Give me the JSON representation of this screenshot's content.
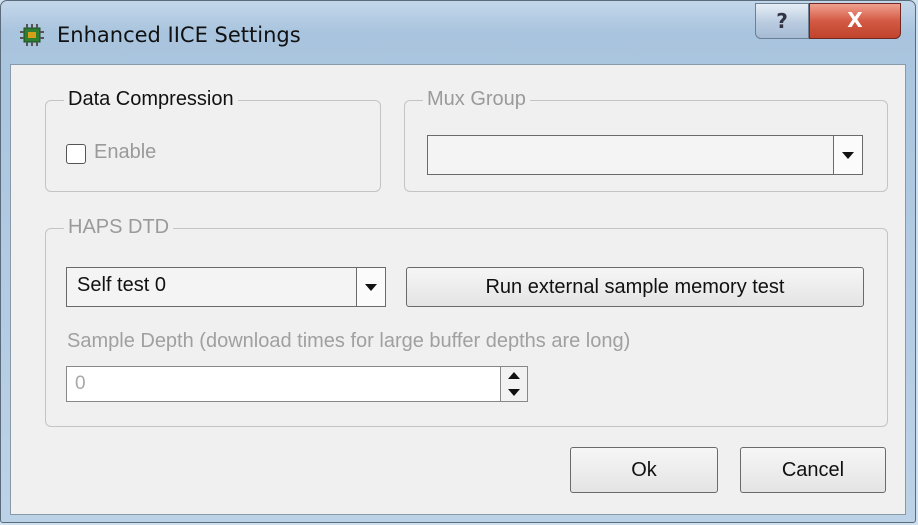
{
  "window": {
    "title": "Enhanced IICE Settings",
    "help_glyph": "?",
    "close_glyph": "X",
    "app_icon": "chip-icon"
  },
  "data_compression": {
    "legend": "Data Compression",
    "enable_label": "Enable",
    "enable_checked": false
  },
  "mux_group": {
    "legend": "Mux Group",
    "selected": ""
  },
  "haps_dtd": {
    "legend": "HAPS DTD",
    "self_test_selected": "Self test 0",
    "run_test_label": "Run external sample memory test",
    "sample_depth_hint": "Sample Depth (download times for large buffer depths are long)",
    "sample_depth_value": "0"
  },
  "footer": {
    "ok_label": "Ok",
    "cancel_label": "Cancel"
  },
  "colors": {
    "close_button": "#c0432d",
    "disabled_text": "#9a9a9a"
  }
}
